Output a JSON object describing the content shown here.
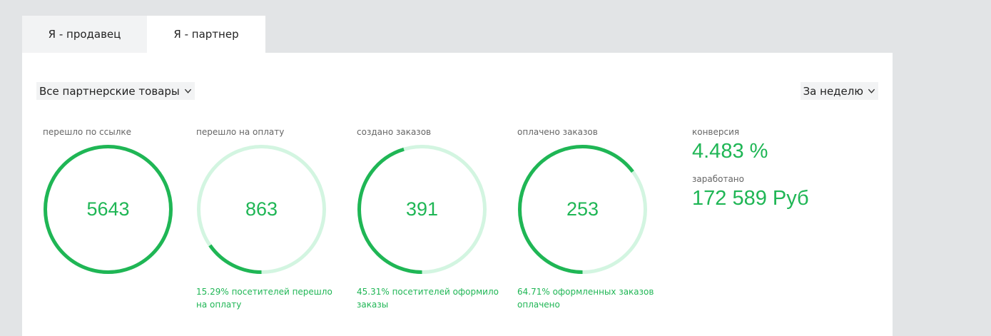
{
  "tabs": [
    {
      "label": "Я - продавец",
      "active": false
    },
    {
      "label": "Я - партнер",
      "active": true
    }
  ],
  "filters": {
    "products": "Все партнерские товары",
    "period": "За неделю"
  },
  "stats": [
    {
      "label": "перешло по ссылке",
      "value": "5643",
      "progress": 1.0,
      "note": ""
    },
    {
      "label": "перешло на оплату",
      "value": "863",
      "progress": 0.1529,
      "note": "15.29% посетителей перешло на оплату"
    },
    {
      "label": "создано заказов",
      "value": "391",
      "progress": 0.4531,
      "note": "45.31% посетителей оформило заказы"
    },
    {
      "label": "оплачено заказов",
      "value": "253",
      "progress": 0.6471,
      "note": "64.71% оформленных заказов оплачено"
    }
  ],
  "summary": {
    "conversion_label": "конверсия",
    "conversion_value": "4.483 %",
    "earned_label": "заработано",
    "earned_value": "172 589 Руб"
  },
  "colors": {
    "accent": "#1fb655",
    "track": "#d3f5e1",
    "background": "#e2e4e6",
    "panel": "#ffffff"
  },
  "icons": {
    "dropdown": "chevron-down-icon"
  }
}
